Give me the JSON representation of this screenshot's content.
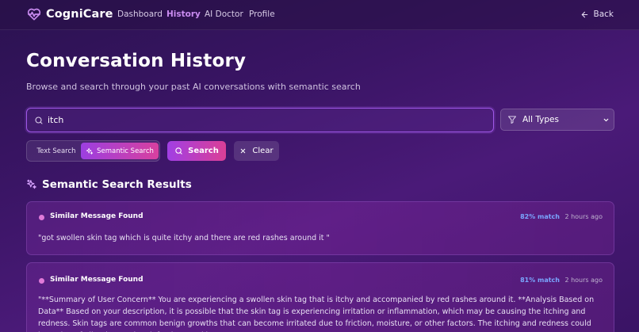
{
  "nav": {
    "brand": "CogniCare",
    "links": [
      {
        "label": "Dashboard",
        "active": false
      },
      {
        "label": "History",
        "active": true
      },
      {
        "label": "AI Doctor",
        "active": false
      },
      {
        "label": "Profile",
        "active": false
      }
    ],
    "back_label": "Back"
  },
  "page": {
    "title": "Conversation History",
    "subtitle": "Browse and search through your past AI conversations with semantic search"
  },
  "search": {
    "value": "itch",
    "type_filter": "All Types",
    "mode_text": "Text Search",
    "mode_semantic": "Semantic Search",
    "active_mode": "semantic",
    "search_label": "Search",
    "clear_label": "Clear"
  },
  "results": {
    "title": "Semantic Search Results",
    "items": [
      {
        "heading": "Similar Message Found",
        "match": "82% match",
        "time": "2 hours ago",
        "text": "\"got swollen skin tag which is quite itchy and there are red rashes around it \""
      },
      {
        "heading": "Similar Message Found",
        "match": "81% match",
        "time": "2 hours ago",
        "text": "\"**Summary of User Concern** You are experiencing a swollen skin tag that is itchy and accompanied by red rashes around it. **Analysis Based on Data** Based on your description, it is possible that the skin tag is experiencing irritation or inflammation, which may be causing the itching and redness. Skin tags are common benign growths that can become irritated due to friction, moisture, or other factors. The itching and redness could be a sign of allergic reaction, infection, or skin"
      }
    ]
  },
  "colors": {
    "accent": "#a058e8",
    "brand_gradient_start": "#9c3fe0",
    "brand_gradient_end": "#d8409f",
    "active_nav": "#c98bf0",
    "match_text": "#7aa6ff",
    "result_dot": "#e07ad8"
  },
  "icons": {
    "brand": "heart-pulse-icon",
    "back": "arrow-left-icon",
    "search": "search-icon",
    "filter": "filter-icon",
    "chevron": "chevron-down-icon",
    "sparkles": "sparkles-icon",
    "clear": "close-icon"
  }
}
